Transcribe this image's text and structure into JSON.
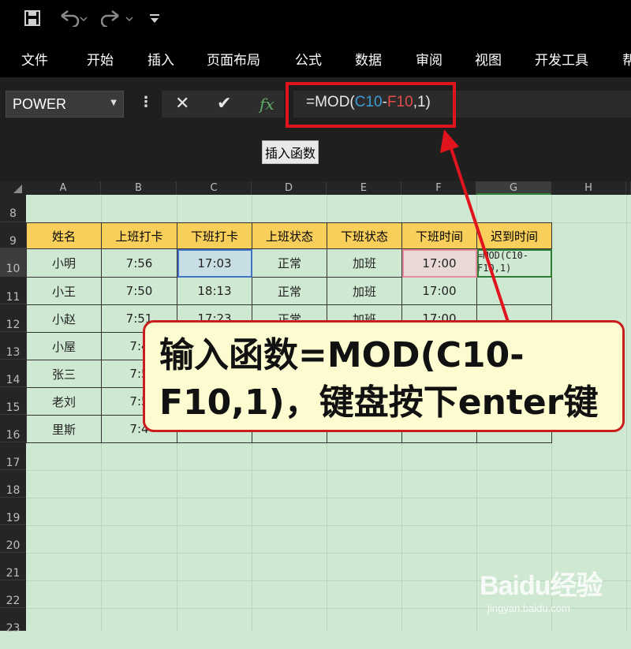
{
  "quick_access": {
    "save_icon": "save-icon",
    "undo_icon": "undo-icon",
    "redo_icon": "redo-icon",
    "customize_icon": "customize-icon"
  },
  "ribbon": {
    "tabs": [
      "文件",
      "开始",
      "插入",
      "页面布局",
      "公式",
      "数据",
      "审阅",
      "视图",
      "开发工具",
      "帮"
    ]
  },
  "formula_bar": {
    "name_box": "POWER",
    "formula_prefix": "=MOD(",
    "ref1": "C10",
    "minus": "-",
    "ref2": "F10",
    "formula_suffix": ",1)",
    "tooltip": "插入函数",
    "fx_label": "fx"
  },
  "columns": [
    "A",
    "B",
    "C",
    "D",
    "E",
    "F",
    "G",
    "H"
  ],
  "rows": [
    "8",
    "9",
    "10",
    "11",
    "12",
    "13",
    "14",
    "15",
    "16",
    "17",
    "18",
    "19",
    "20",
    "21",
    "22",
    "23"
  ],
  "table": {
    "headers": [
      "姓名",
      "上班打卡",
      "下班打卡",
      "上班状态",
      "下班状态",
      "下班时间",
      "迟到时间"
    ],
    "rows": [
      [
        "小明",
        "7:56",
        "17:03",
        "正常",
        "加班",
        "17:00",
        "=MOD(C10-F10,1)"
      ],
      [
        "小王",
        "7:50",
        "18:13",
        "正常",
        "加班",
        "17:00",
        ""
      ],
      [
        "小赵",
        "7:51",
        "17:23",
        "正常",
        "加班",
        "17:00",
        ""
      ],
      [
        "小屋",
        "7:4",
        "",
        "",
        "",
        "",
        ""
      ],
      [
        "张三",
        "7:5",
        "",
        "",
        "",
        "",
        ""
      ],
      [
        "老刘",
        "7:5",
        "",
        "",
        "",
        "",
        ""
      ],
      [
        "里斯",
        "7:4",
        "",
        "",
        "",
        "",
        ""
      ]
    ]
  },
  "callout": {
    "text": "输入函数=MOD(C10-F10,1)，键盘按下enter键"
  },
  "watermark": {
    "logo": "Baidu经验",
    "url": "jingyan.baidu.com"
  },
  "colors": {
    "header_fill": "#f9cf5c",
    "sheet_bg": "#cfe8d2",
    "highlight_red": "#e0141d",
    "callout_bg": "#fdfbd0"
  }
}
